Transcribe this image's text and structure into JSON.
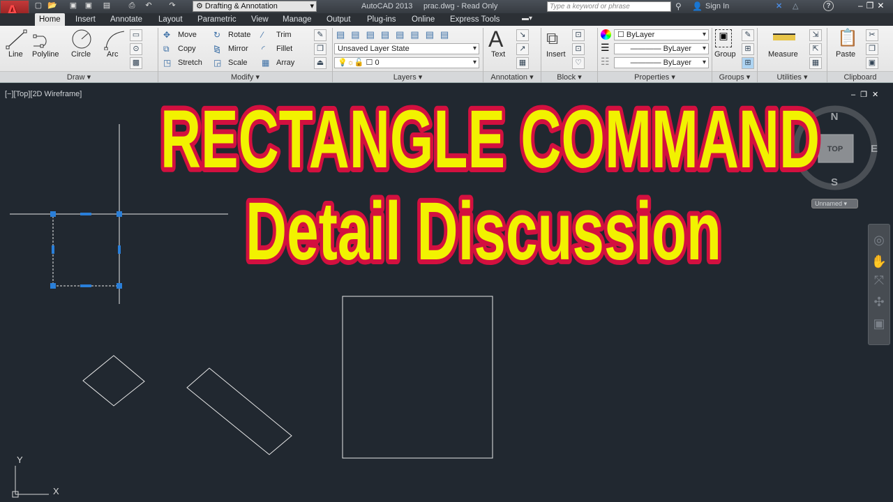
{
  "titlebar": {
    "app_title": "AutoCAD 2013",
    "file_title": "prac.dwg - Read Only",
    "workspace": "Drafting & Annotation",
    "search_placeholder": "Type a keyword or phrase",
    "sign_in": "Sign In",
    "help": "?"
  },
  "tabs": [
    "Home",
    "Insert",
    "Annotate",
    "Layout",
    "Parametric",
    "View",
    "Manage",
    "Output",
    "Plug-ins",
    "Online",
    "Express Tools"
  ],
  "ribbon": {
    "draw": {
      "label": "Draw",
      "tools": [
        "Line",
        "Polyline",
        "Circle",
        "Arc"
      ]
    },
    "modify": {
      "label": "Modify",
      "tools": [
        "Move",
        "Rotate",
        "Trim",
        "Copy",
        "Mirror",
        "Fillet",
        "Stretch",
        "Scale",
        "Array"
      ]
    },
    "layers": {
      "label": "Layers",
      "layer_state": "Unsaved Layer State",
      "current_layer": "0"
    },
    "annotation": {
      "label": "Annotation",
      "text": "Text"
    },
    "block": {
      "label": "Block",
      "insert": "Insert"
    },
    "properties": {
      "label": "Properties",
      "color": "ByLayer",
      "lineweight": "ByLayer",
      "linetype": "ByLayer"
    },
    "groups": {
      "label": "Groups",
      "group": "Group"
    },
    "utilities": {
      "label": "Utilities",
      "measure": "Measure"
    },
    "clipboard": {
      "label": "Clipboard",
      "paste": "Paste"
    }
  },
  "viewport": {
    "label": "[−][Top][2D Wireframe]",
    "viewcube": {
      "face": "TOP",
      "n": "N",
      "e": "E",
      "s": "S"
    },
    "ucs_name": "Unnamed",
    "ucs_x": "X",
    "ucs_y": "Y"
  },
  "overlay": {
    "line1": "RECTANGLE COMMAND",
    "line2": "Detail Discussion",
    "fill": "#f2f200",
    "stroke": "#d3103f"
  }
}
